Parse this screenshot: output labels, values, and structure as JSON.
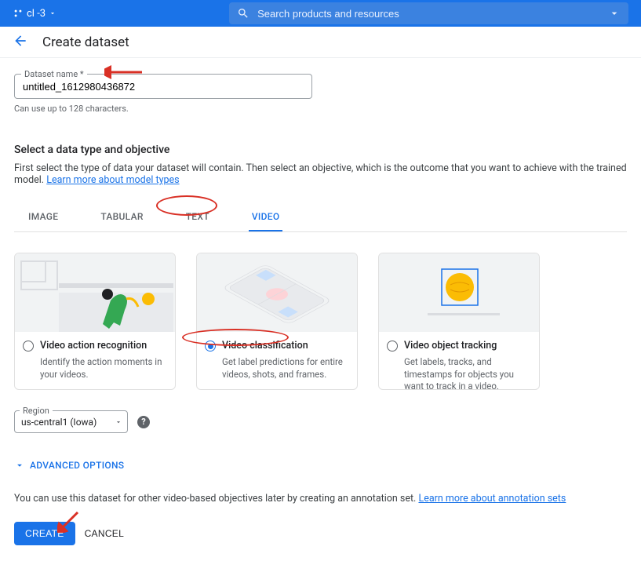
{
  "header": {
    "project_name": "cl           -3",
    "search_placeholder": "Search products and resources"
  },
  "page": {
    "title": "Create dataset"
  },
  "dataset_name": {
    "label": "Dataset name *",
    "value": "untitled_1612980436872",
    "hint": "Can use up to 128 characters."
  },
  "section": {
    "title": "Select a data type and objective",
    "desc": "First select the type of data your dataset will contain. Then select an objective, which is the outcome that you want to achieve with the trained model.",
    "link": "Learn more about model types"
  },
  "tabs": [
    {
      "label": "IMAGE",
      "active": false
    },
    {
      "label": "TABULAR",
      "active": false
    },
    {
      "label": "TEXT",
      "active": false
    },
    {
      "label": "VIDEO",
      "active": true
    }
  ],
  "cards": [
    {
      "id": "action",
      "title": "Video action recognition",
      "desc": "Identify the action moments in your videos.",
      "selected": false
    },
    {
      "id": "classification",
      "title": "Video classification",
      "desc": "Get label predictions for entire videos, shots, and frames.",
      "selected": true
    },
    {
      "id": "tracking",
      "title": "Video object tracking",
      "desc": "Get labels, tracks, and timestamps for objects you want to track in a video.",
      "selected": false
    }
  ],
  "region": {
    "label": "Region",
    "value": "us-central1 (Iowa)"
  },
  "adv_label": "ADVANCED OPTIONS",
  "note": {
    "text": "You can use this dataset for other video-based objectives later by creating an annotation set.",
    "link": "Learn more about annotation sets"
  },
  "actions": {
    "create": "CREATE",
    "cancel": "CANCEL"
  }
}
